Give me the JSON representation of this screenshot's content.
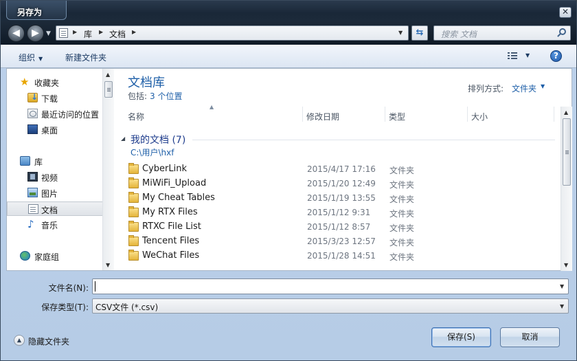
{
  "window": {
    "title": "另存为",
    "close_glyph": "✕"
  },
  "nav": {
    "back_glyph": "◀",
    "forward_glyph": "▶",
    "breadcrumb": [
      "库",
      "文档"
    ],
    "refresh_glyph": "⇆",
    "search_placeholder": "搜索 文档"
  },
  "toolbar": {
    "organize": "组织",
    "new_folder": "新建文件夹",
    "help": "?"
  },
  "sidebar": {
    "items": [
      {
        "label": "收藏夹",
        "icon": "favorites-star-icon",
        "indent": false
      },
      {
        "label": "下载",
        "icon": "downloads-folder-icon",
        "indent": true
      },
      {
        "label": "最近访问的位置",
        "icon": "recent-places-icon",
        "indent": true
      },
      {
        "label": "桌面",
        "icon": "desktop-icon",
        "indent": true
      },
      {
        "label": "库",
        "icon": "libraries-icon",
        "indent": false
      },
      {
        "label": "视频",
        "icon": "videos-icon",
        "indent": true
      },
      {
        "label": "图片",
        "icon": "pictures-icon",
        "indent": true
      },
      {
        "label": "文档",
        "icon": "documents-icon",
        "indent": true,
        "selected": true
      },
      {
        "label": "音乐",
        "icon": "music-icon",
        "indent": true
      },
      {
        "label": "家庭组",
        "icon": "homegroup-icon",
        "indent": false
      }
    ]
  },
  "library": {
    "title": "文档库",
    "includes_prefix": "包括:",
    "includes_link": "3 个位置",
    "arrange_label": "排列方式:",
    "arrange_value": "文件夹"
  },
  "columns": [
    "名称",
    "修改日期",
    "类型",
    "大小"
  ],
  "group": {
    "title": "我的文档 (7)",
    "path": "C:\\用户\\hxf"
  },
  "files": [
    {
      "name": "CyberLink",
      "date": "2015/4/17 17:16",
      "type": "文件夹"
    },
    {
      "name": "MiWiFi_Upload",
      "date": "2015/1/20 12:49",
      "type": "文件夹"
    },
    {
      "name": "My Cheat Tables",
      "date": "2015/1/19 13:55",
      "type": "文件夹"
    },
    {
      "name": "My RTX Files",
      "date": "2015/1/12 9:31",
      "type": "文件夹"
    },
    {
      "name": "RTXC File List",
      "date": "2015/1/12 8:57",
      "type": "文件夹"
    },
    {
      "name": "Tencent Files",
      "date": "2015/3/23 12:57",
      "type": "文件夹"
    },
    {
      "name": "WeChat Files",
      "date": "2015/1/28 14:51",
      "type": "文件夹"
    }
  ],
  "form": {
    "filename_label": "文件名(N):",
    "filename_value": "",
    "filetype_label": "保存类型(T):",
    "filetype_value": "CSV文件 (*.csv)"
  },
  "footer": {
    "hide_folders": "隐藏文件夹",
    "save": "保存(S)",
    "cancel": "取消"
  }
}
